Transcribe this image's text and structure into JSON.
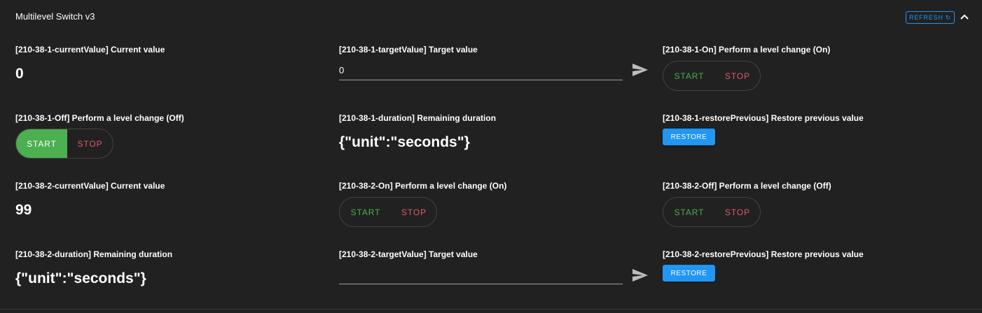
{
  "panel": {
    "title": "Multilevel Switch v3",
    "refresh_label": "REFRESH",
    "refresh_icon": "refresh-icon",
    "collapse_icon": "chevron-up-icon"
  },
  "colors": {
    "background": "#212121",
    "accent_blue": "#2196f3",
    "start_green": "#4caf50",
    "stop_red": "#e05a67"
  },
  "buttons": {
    "start": "START",
    "stop": "STOP",
    "restore": "RESTORE"
  },
  "cells": {
    "c1": {
      "label": "[210-38-1-currentValue] Current value",
      "value": "0"
    },
    "c2": {
      "label": "[210-38-1-targetValue] Target value",
      "value": "0",
      "send_icon": "send-icon"
    },
    "c3": {
      "label": "[210-38-1-On] Perform a level change (On)",
      "active": "none"
    },
    "c4": {
      "label": "[210-38-1-Off] Perform a level change (Off)",
      "active": "start"
    },
    "c5": {
      "label": "[210-38-1-duration] Remaining duration",
      "value": "{\"unit\":\"seconds\"}"
    },
    "c6": {
      "label": "[210-38-1-restorePrevious] Restore previous value"
    },
    "c7": {
      "label": "[210-38-2-currentValue] Current value",
      "value": "99"
    },
    "c8": {
      "label": "[210-38-2-On] Perform a level change (On)",
      "active": "none"
    },
    "c9": {
      "label": "[210-38-2-Off] Perform a level change (Off)",
      "active": "none"
    },
    "c10": {
      "label": "[210-38-2-duration] Remaining duration",
      "value": "{\"unit\":\"seconds\"}"
    },
    "c11": {
      "label": "[210-38-2-targetValue] Target value",
      "value": "",
      "send_icon": "send-icon"
    },
    "c12": {
      "label": "[210-38-2-restorePrevious] Restore previous value"
    }
  }
}
